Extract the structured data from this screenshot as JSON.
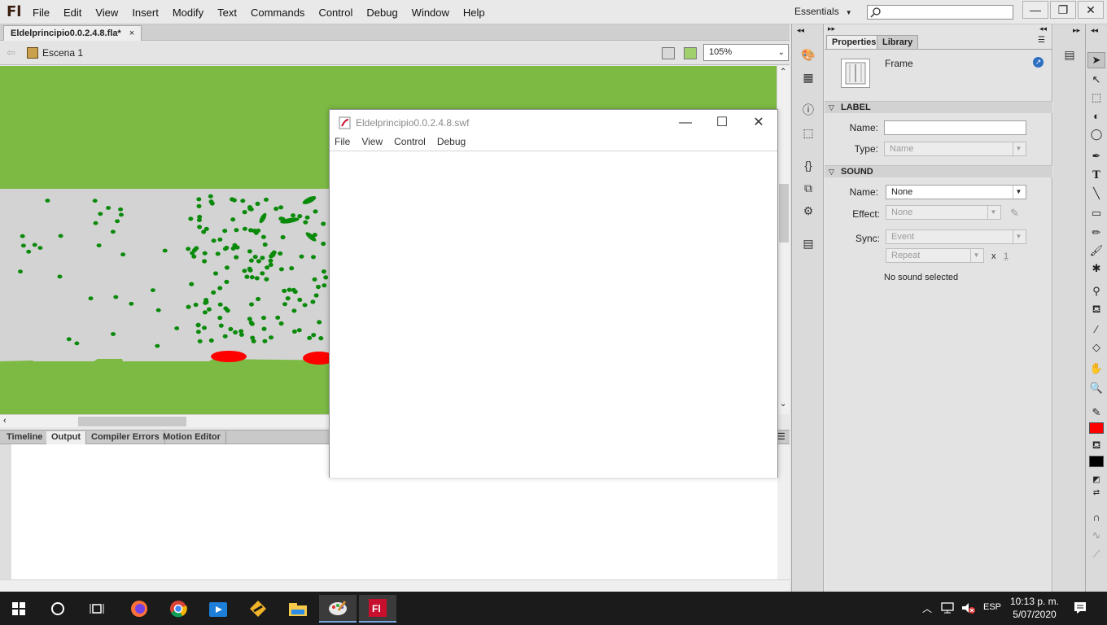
{
  "app": {
    "logo": "Fl"
  },
  "menubar": {
    "items": [
      "File",
      "Edit",
      "View",
      "Insert",
      "Modify",
      "Text",
      "Commands",
      "Control",
      "Debug",
      "Window",
      "Help"
    ],
    "workspace": "Essentials"
  },
  "window_controls": {
    "minimize": "—",
    "restore": "❐",
    "close": "✕"
  },
  "document": {
    "tab": "Eldelprincipio0.0.2.4.8.fla*",
    "tab_close": "×",
    "scene": "Escena 1",
    "zoom": "105%"
  },
  "bottom_panel": {
    "tabs": [
      "Timeline",
      "Output",
      "Compiler Errors",
      "Motion Editor"
    ],
    "active": "Output"
  },
  "properties": {
    "tabs": [
      "Properties",
      "Library"
    ],
    "active_tab": "Properties",
    "object_type": "Frame",
    "label_section": {
      "title": "LABEL",
      "name_label": "Name:",
      "name_value": "",
      "type_label": "Type:",
      "type_value": "Name"
    },
    "sound_section": {
      "title": "SOUND",
      "name_label": "Name:",
      "name_value": "None",
      "effect_label": "Effect:",
      "effect_value": "None",
      "sync_label": "Sync:",
      "sync_value": "Event",
      "repeat_value": "Repeat",
      "times": "x",
      "repeat_count": "1",
      "status": "No sound selected"
    }
  },
  "swf_window": {
    "title": "Eldelprincipio0.0.2.4.8.swf",
    "menu": [
      "File",
      "View",
      "Control",
      "Debug"
    ],
    "controls": {
      "minimize": "—",
      "maximize": "☐",
      "close": "✕"
    }
  },
  "taskbar": {
    "language": "ESP",
    "time": "10:13 p. m.",
    "date": "5/07/2020"
  },
  "colors": {
    "stage_green": "#7cba44",
    "stage_gray": "#d3d3d3",
    "dot_green": "#0a8a0a",
    "red": "#ff0000",
    "fill_color": "#ff0000",
    "stroke_color": "#000000"
  }
}
